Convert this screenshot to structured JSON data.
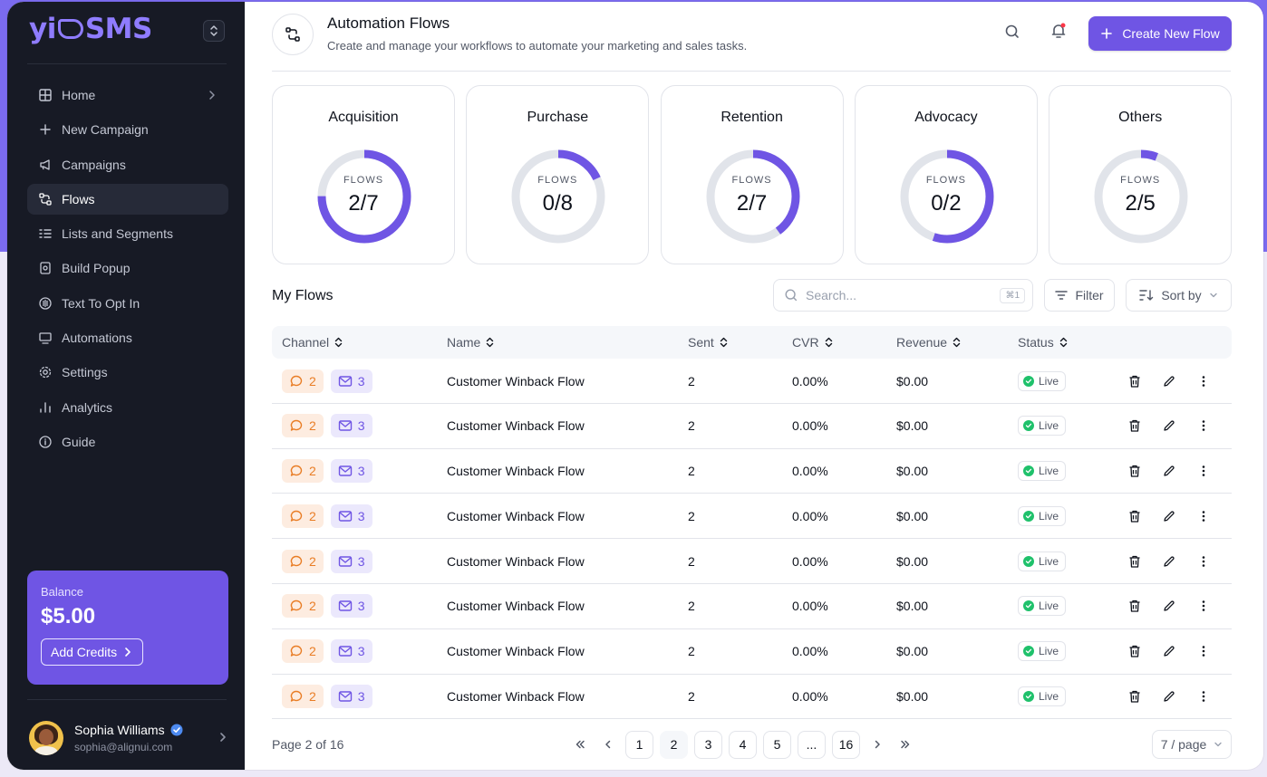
{
  "app": {
    "logo_prefix": "yi",
    "logo_suffix": "SMS"
  },
  "sidebar": {
    "items": [
      {
        "label": "Home",
        "icon": "home-grid-icon",
        "active": false,
        "chevron": true
      },
      {
        "label": "New Campaign",
        "icon": "plus-icon",
        "active": false
      },
      {
        "label": "Campaigns",
        "icon": "megaphone-icon",
        "active": false
      },
      {
        "label": "Flows",
        "icon": "flow-icon",
        "active": true
      },
      {
        "label": "Lists and Segments",
        "icon": "list-icon",
        "active": false
      },
      {
        "label": "Build Popup",
        "icon": "popup-icon",
        "active": false
      },
      {
        "label": "Text To Opt In",
        "icon": "opt-in-icon",
        "active": false
      },
      {
        "label": "Automations",
        "icon": "monitor-icon",
        "active": false
      },
      {
        "label": "Settings",
        "icon": "gear-icon",
        "active": false
      },
      {
        "label": "Analytics",
        "icon": "bar-chart-icon",
        "active": false
      },
      {
        "label": "Guide",
        "icon": "info-icon",
        "active": false
      }
    ],
    "balance": {
      "label": "Balance",
      "amount": "$5.00",
      "button": "Add Credits"
    },
    "user": {
      "name": "Sophia Williams",
      "email": "sophia@alignui.com"
    }
  },
  "header": {
    "title": "Automation Flows",
    "subtitle": "Create and manage your workflows to automate your marketing and sales tasks.",
    "create_button": "Create New Flow"
  },
  "cards": [
    {
      "title": "Acquisition",
      "label": "FLOWS",
      "value": "2/7",
      "progress": 0.75
    },
    {
      "title": "Purchase",
      "label": "FLOWS",
      "value": "0/8",
      "progress": 0.18
    },
    {
      "title": "Retention",
      "label": "FLOWS",
      "value": "2/7",
      "progress": 0.4
    },
    {
      "title": "Advocacy",
      "label": "FLOWS",
      "value": "0/2",
      "progress": 0.55
    },
    {
      "title": "Others",
      "label": "FLOWS",
      "value": "2/5",
      "progress": 0.06
    }
  ],
  "my_flows": {
    "title": "My Flows",
    "search_placeholder": "Search...",
    "search_shortcut": "⌘1",
    "filter_label": "Filter",
    "sort_label": "Sort by",
    "columns": [
      "Channel",
      "Name",
      "Sent",
      "CVR",
      "Revenue",
      "Status"
    ],
    "rows": [
      {
        "sms": "2",
        "mail": "3",
        "name": "Customer Winback Flow",
        "sent": "2",
        "cvr": "0.00%",
        "revenue": "$0.00",
        "status": "Live"
      },
      {
        "sms": "2",
        "mail": "3",
        "name": "Customer Winback Flow",
        "sent": "2",
        "cvr": "0.00%",
        "revenue": "$0.00",
        "status": "Live"
      },
      {
        "sms": "2",
        "mail": "3",
        "name": "Customer Winback Flow",
        "sent": "2",
        "cvr": "0.00%",
        "revenue": "$0.00",
        "status": "Live"
      },
      {
        "sms": "2",
        "mail": "3",
        "name": "Customer Winback Flow",
        "sent": "2",
        "cvr": "0.00%",
        "revenue": "$0.00",
        "status": "Live"
      },
      {
        "sms": "2",
        "mail": "3",
        "name": "Customer Winback Flow",
        "sent": "2",
        "cvr": "0.00%",
        "revenue": "$0.00",
        "status": "Live"
      },
      {
        "sms": "2",
        "mail": "3",
        "name": "Customer Winback Flow",
        "sent": "2",
        "cvr": "0.00%",
        "revenue": "$0.00",
        "status": "Live"
      },
      {
        "sms": "2",
        "mail": "3",
        "name": "Customer Winback Flow",
        "sent": "2",
        "cvr": "0.00%",
        "revenue": "$0.00",
        "status": "Live"
      },
      {
        "sms": "2",
        "mail": "3",
        "name": "Customer Winback Flow",
        "sent": "2",
        "cvr": "0.00%",
        "revenue": "$0.00",
        "status": "Live"
      }
    ]
  },
  "pagination": {
    "label": "Page 2 of 16",
    "pages": [
      "1",
      "2",
      "3",
      "4",
      "5",
      "...",
      "16"
    ],
    "current": "2",
    "per_page": "7 / page"
  },
  "colors": {
    "accent": "#6f55e4",
    "ring_track": "#e1e4ea",
    "live": "#1fc16b"
  }
}
